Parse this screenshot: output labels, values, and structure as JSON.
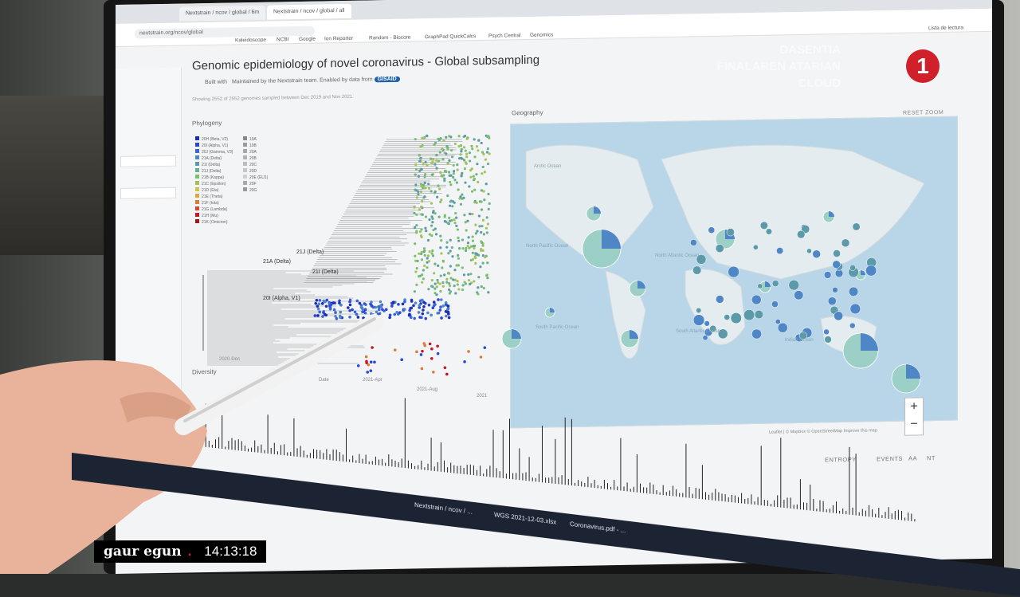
{
  "browser": {
    "tabs": [
      "Nextstrain / ncov / global / 6m",
      "Nextstrain / ncov / global / all"
    ],
    "bookmarks": [
      "Kaleidoscope",
      "NCBI",
      "Google",
      "Ion Reporter",
      "Random - Biocore",
      "GraphPad QuickCalcs",
      "Psych Central",
      "Genomics",
      "Lista de lectura"
    ]
  },
  "page": {
    "title": "Genomic epidemiology of novel coronavirus - Global subsampling",
    "built_with": "Built with",
    "maintained_by": "Maintained by the Nextstrain team. Enabled by data from",
    "gisaid": "GISAID",
    "genome_count": "Showing 2552 of 2552 genomes sampled between Dec 2019 and Nov 2021."
  },
  "phylogeny": {
    "title": "Phylogeny",
    "legend": [
      {
        "label": "20H (Beta, V2)",
        "color": "#1c2fb5"
      },
      {
        "label": "20I (Alpha, V1)",
        "color": "#2a46d4"
      },
      {
        "label": "20J (Gamma, V3)",
        "color": "#3b64d8"
      },
      {
        "label": "21A (Delta)",
        "color": "#4f86c6"
      },
      {
        "label": "21I (Delta)",
        "color": "#5c9aa9"
      },
      {
        "label": "21J (Delta)",
        "color": "#69b08c"
      },
      {
        "label": "21B (Kappa)",
        "color": "#7dbf6e"
      },
      {
        "label": "21C (Epsilon)",
        "color": "#a3c35a"
      },
      {
        "label": "21D (Eta)",
        "color": "#c9c24b"
      },
      {
        "label": "21E (Theta)",
        "color": "#e0a93f"
      },
      {
        "label": "21F (Iota)",
        "color": "#e07b35"
      },
      {
        "label": "21G (Lambda)",
        "color": "#d9452f"
      },
      {
        "label": "21H (Mu)",
        "color": "#c4182a"
      },
      {
        "label": "21K (Omicron)",
        "color": "#a81320"
      },
      {
        "label": "19A",
        "color": "#888888"
      },
      {
        "label": "19B",
        "color": "#9a9a9a"
      },
      {
        "label": "20A",
        "color": "#a6a6a6"
      },
      {
        "label": "20B",
        "color": "#b2b2b2"
      },
      {
        "label": "20C",
        "color": "#bcbcbc"
      },
      {
        "label": "20D",
        "color": "#c6c6c6"
      },
      {
        "label": "20E (EU1)",
        "color": "#d0d0d0"
      },
      {
        "label": "20F",
        "color": "#aaaaaa"
      },
      {
        "label": "20G",
        "color": "#999999"
      }
    ],
    "clade_labels": [
      "21J (Delta)",
      "21A (Delta)",
      "21I (Delta)",
      "20I (Alpha, V1)"
    ],
    "axis_ticks": [
      "2020-Dec",
      "2021-Apr",
      "2021-Aug",
      "2021"
    ],
    "date_label": "Date"
  },
  "geography": {
    "title": "Geography",
    "reset_zoom": "RESET ZOOM",
    "ocean_labels": [
      "North Pacific Ocean",
      "North Atlantic Ocean",
      "South Pacific Ocean",
      "South Atlantic Ocean",
      "Indian Ocean",
      "Arctic Ocean"
    ],
    "attribution": "Leaflet | © Mapbox © OpenStreetMap Improve this map",
    "zoom_in": "+",
    "zoom_out": "−"
  },
  "entropy": {
    "title": "Diversity",
    "tabs": [
      "ENTROPY",
      "EVENTS",
      "AA",
      "NT"
    ]
  },
  "taskbar": {
    "items": [
      "Nextstrain / ncov / ...",
      "WGS 2021-12-03.xlsx",
      "Coronavirus.pdf - ..."
    ]
  },
  "broadcast": {
    "channel_number": "1",
    "watermark": [
      "DASENTIA",
      "FINALAREN ATARIAN",
      "CLOUD"
    ],
    "program": "gaur egun",
    "time": "14:13:18"
  },
  "colors": {
    "alpha_blue": "#2a46d4",
    "delta_green": "#7dbf6e",
    "omicron_red": "#c4182a",
    "gisaid_blue": "#1d5fa8",
    "channel_red": "#d0202a"
  }
}
